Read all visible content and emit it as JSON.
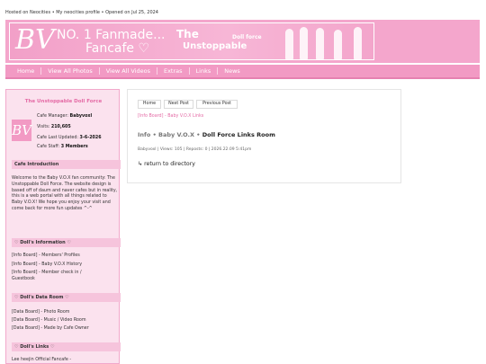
{
  "topbar": {
    "hosted": "Hosted on Neocities",
    "profile": "My neocities profile",
    "opened": "Opened on Jul 25, 2024",
    "sep": "•"
  },
  "banner": {
    "logo": "BV",
    "line1": "NO. 1 Fanmade...",
    "line2": "Fancafe ♡",
    "title1": "The",
    "title2": "Unstoppable",
    "badge": "Doll force"
  },
  "nav": [
    "Home",
    "View All Photos",
    "View All Videos",
    "Extras",
    "Links",
    "News"
  ],
  "sidebar": {
    "title": "The Unstoppable Doll Force",
    "logo": "BV",
    "manager_label": "Cafe Manager:",
    "manager_value": "Babyvoxl",
    "visits_label": "Visits:",
    "visits_value": "210,605",
    "updated_label": "Cafe Last Updated:",
    "updated_value": "3-6-2026",
    "staff_label": "Cafe Staff:",
    "staff_value": "3 Members",
    "intro_head": "Cafe Introduction",
    "intro_text": "Welcome to the Baby V.O.X fan community: The Unstoppable Doll Force. The website design is based off of daum and naver cafes but in reality, this is a web portal with all things related to Baby V.O.X! We hope you enjoy your visit and come back for more fun updates ^-^",
    "info_head": "♡ Doll's Information ♡",
    "info_links": [
      "[Info Board] - Members' Profiles",
      "[Info Board] - Baby V.O.X History",
      "[Info Board] - Member check in /",
      "Guestbook"
    ],
    "data_head": "♡ Doll's Data Room ♡",
    "data_links": [
      "[Data Board] - Photo Room",
      "[Data Board] - Music / Video Room",
      "[Data Board] - Made by Cafe Owner"
    ],
    "links_head": "♡ Doll's Links ♡",
    "links_links": [
      "Lee heejin Official Fancafe -"
    ]
  },
  "main": {
    "buttons": [
      "Home",
      "Next Post",
      "Previous Post"
    ],
    "breadcrumb": "[Info Board] - Baby V.O.X Links",
    "title_prefix": "Info • Baby V.O.X •",
    "title_main": "Doll Force Links Room",
    "meta": "Babyvoxl | Views: 105 | Reposts: 0 | 2026.22.09 5:41pm",
    "return": "↳ return to directory"
  }
}
